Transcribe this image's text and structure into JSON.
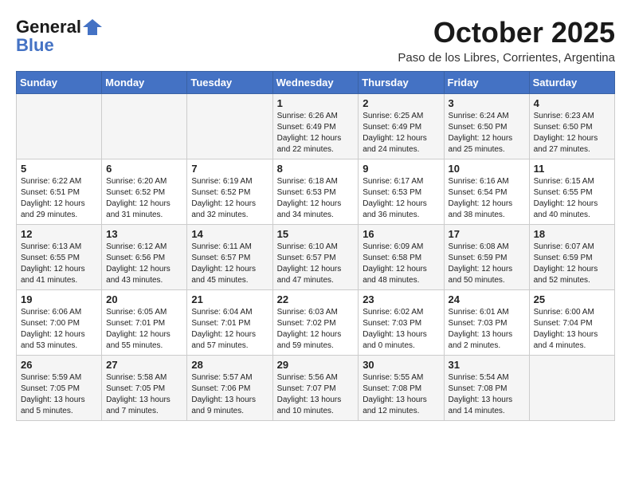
{
  "header": {
    "logo_line1": "General",
    "logo_line2": "Blue",
    "month": "October 2025",
    "location": "Paso de los Libres, Corrientes, Argentina"
  },
  "days_of_week": [
    "Sunday",
    "Monday",
    "Tuesday",
    "Wednesday",
    "Thursday",
    "Friday",
    "Saturday"
  ],
  "weeks": [
    [
      {
        "day": "",
        "content": ""
      },
      {
        "day": "",
        "content": ""
      },
      {
        "day": "",
        "content": ""
      },
      {
        "day": "1",
        "content": "Sunrise: 6:26 AM\nSunset: 6:49 PM\nDaylight: 12 hours and 22 minutes."
      },
      {
        "day": "2",
        "content": "Sunrise: 6:25 AM\nSunset: 6:49 PM\nDaylight: 12 hours and 24 minutes."
      },
      {
        "day": "3",
        "content": "Sunrise: 6:24 AM\nSunset: 6:50 PM\nDaylight: 12 hours and 25 minutes."
      },
      {
        "day": "4",
        "content": "Sunrise: 6:23 AM\nSunset: 6:50 PM\nDaylight: 12 hours and 27 minutes."
      }
    ],
    [
      {
        "day": "5",
        "content": "Sunrise: 6:22 AM\nSunset: 6:51 PM\nDaylight: 12 hours and 29 minutes."
      },
      {
        "day": "6",
        "content": "Sunrise: 6:20 AM\nSunset: 6:52 PM\nDaylight: 12 hours and 31 minutes."
      },
      {
        "day": "7",
        "content": "Sunrise: 6:19 AM\nSunset: 6:52 PM\nDaylight: 12 hours and 32 minutes."
      },
      {
        "day": "8",
        "content": "Sunrise: 6:18 AM\nSunset: 6:53 PM\nDaylight: 12 hours and 34 minutes."
      },
      {
        "day": "9",
        "content": "Sunrise: 6:17 AM\nSunset: 6:53 PM\nDaylight: 12 hours and 36 minutes."
      },
      {
        "day": "10",
        "content": "Sunrise: 6:16 AM\nSunset: 6:54 PM\nDaylight: 12 hours and 38 minutes."
      },
      {
        "day": "11",
        "content": "Sunrise: 6:15 AM\nSunset: 6:55 PM\nDaylight: 12 hours and 40 minutes."
      }
    ],
    [
      {
        "day": "12",
        "content": "Sunrise: 6:13 AM\nSunset: 6:55 PM\nDaylight: 12 hours and 41 minutes."
      },
      {
        "day": "13",
        "content": "Sunrise: 6:12 AM\nSunset: 6:56 PM\nDaylight: 12 hours and 43 minutes."
      },
      {
        "day": "14",
        "content": "Sunrise: 6:11 AM\nSunset: 6:57 PM\nDaylight: 12 hours and 45 minutes."
      },
      {
        "day": "15",
        "content": "Sunrise: 6:10 AM\nSunset: 6:57 PM\nDaylight: 12 hours and 47 minutes."
      },
      {
        "day": "16",
        "content": "Sunrise: 6:09 AM\nSunset: 6:58 PM\nDaylight: 12 hours and 48 minutes."
      },
      {
        "day": "17",
        "content": "Sunrise: 6:08 AM\nSunset: 6:59 PM\nDaylight: 12 hours and 50 minutes."
      },
      {
        "day": "18",
        "content": "Sunrise: 6:07 AM\nSunset: 6:59 PM\nDaylight: 12 hours and 52 minutes."
      }
    ],
    [
      {
        "day": "19",
        "content": "Sunrise: 6:06 AM\nSunset: 7:00 PM\nDaylight: 12 hours and 53 minutes."
      },
      {
        "day": "20",
        "content": "Sunrise: 6:05 AM\nSunset: 7:01 PM\nDaylight: 12 hours and 55 minutes."
      },
      {
        "day": "21",
        "content": "Sunrise: 6:04 AM\nSunset: 7:01 PM\nDaylight: 12 hours and 57 minutes."
      },
      {
        "day": "22",
        "content": "Sunrise: 6:03 AM\nSunset: 7:02 PM\nDaylight: 12 hours and 59 minutes."
      },
      {
        "day": "23",
        "content": "Sunrise: 6:02 AM\nSunset: 7:03 PM\nDaylight: 13 hours and 0 minutes."
      },
      {
        "day": "24",
        "content": "Sunrise: 6:01 AM\nSunset: 7:03 PM\nDaylight: 13 hours and 2 minutes."
      },
      {
        "day": "25",
        "content": "Sunrise: 6:00 AM\nSunset: 7:04 PM\nDaylight: 13 hours and 4 minutes."
      }
    ],
    [
      {
        "day": "26",
        "content": "Sunrise: 5:59 AM\nSunset: 7:05 PM\nDaylight: 13 hours and 5 minutes."
      },
      {
        "day": "27",
        "content": "Sunrise: 5:58 AM\nSunset: 7:05 PM\nDaylight: 13 hours and 7 minutes."
      },
      {
        "day": "28",
        "content": "Sunrise: 5:57 AM\nSunset: 7:06 PM\nDaylight: 13 hours and 9 minutes."
      },
      {
        "day": "29",
        "content": "Sunrise: 5:56 AM\nSunset: 7:07 PM\nDaylight: 13 hours and 10 minutes."
      },
      {
        "day": "30",
        "content": "Sunrise: 5:55 AM\nSunset: 7:08 PM\nDaylight: 13 hours and 12 minutes."
      },
      {
        "day": "31",
        "content": "Sunrise: 5:54 AM\nSunset: 7:08 PM\nDaylight: 13 hours and 14 minutes."
      },
      {
        "day": "",
        "content": ""
      }
    ]
  ]
}
